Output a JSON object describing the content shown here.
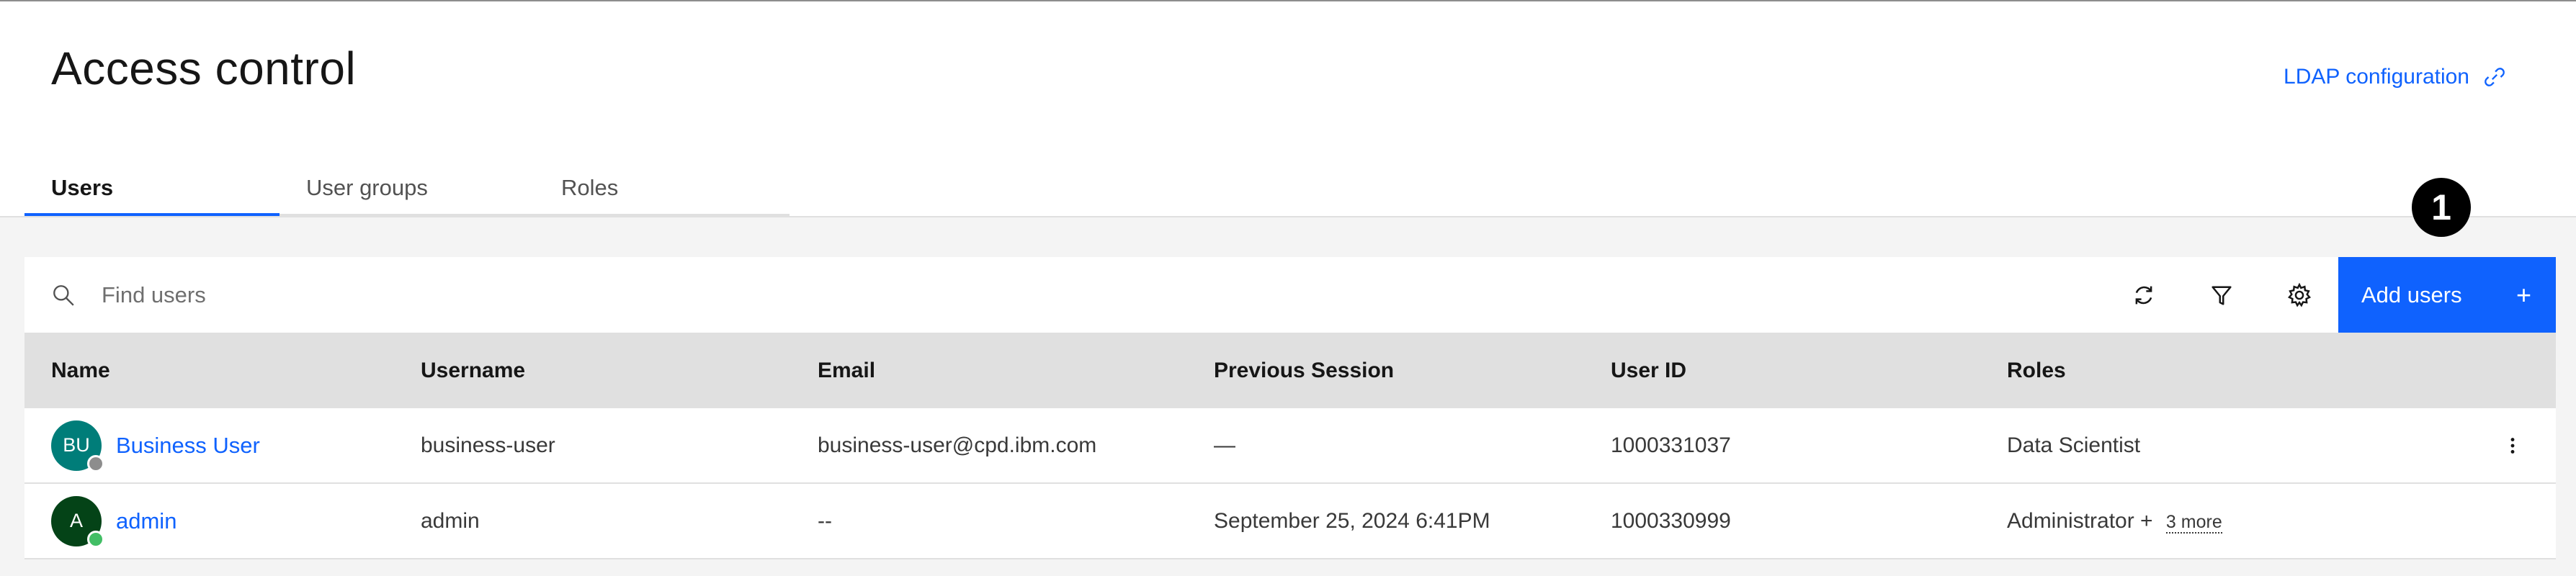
{
  "header": {
    "title": "Access control",
    "ldap_link": "LDAP configuration"
  },
  "tabs": [
    {
      "label": "Users",
      "active": true
    },
    {
      "label": "User groups",
      "active": false
    },
    {
      "label": "Roles",
      "active": false
    }
  ],
  "callout": "1",
  "toolbar": {
    "search_placeholder": "Find users",
    "refresh_icon": "refresh-icon",
    "filter_icon": "filter-icon",
    "settings_icon": "gear-icon",
    "add_label": "Add users",
    "add_icon": "+"
  },
  "table": {
    "columns": [
      "Name",
      "Username",
      "Email",
      "Previous Session",
      "User ID",
      "Roles"
    ],
    "rows": [
      {
        "initials": "BU",
        "avatar_color": "#007d79",
        "status_color": "#8d8d8d",
        "name": "Business User",
        "username": "business-user",
        "email": "business-user@cpd.ibm.com",
        "previous_session": "—",
        "user_id": "1000331037",
        "roles": "Data Scientist",
        "more_roles": ""
      },
      {
        "initials": "A",
        "avatar_color": "#044317",
        "status_color": "#42be65",
        "name": "admin",
        "username": "admin",
        "email": "--",
        "previous_session": "September 25, 2024 6:41PM",
        "user_id": "1000330999",
        "roles": "Administrator +",
        "more_roles": "3 more"
      }
    ]
  },
  "colors": {
    "accent": "#0f62fe",
    "header_bg": "#e0e0e0",
    "page_bg": "#f4f4f4"
  }
}
